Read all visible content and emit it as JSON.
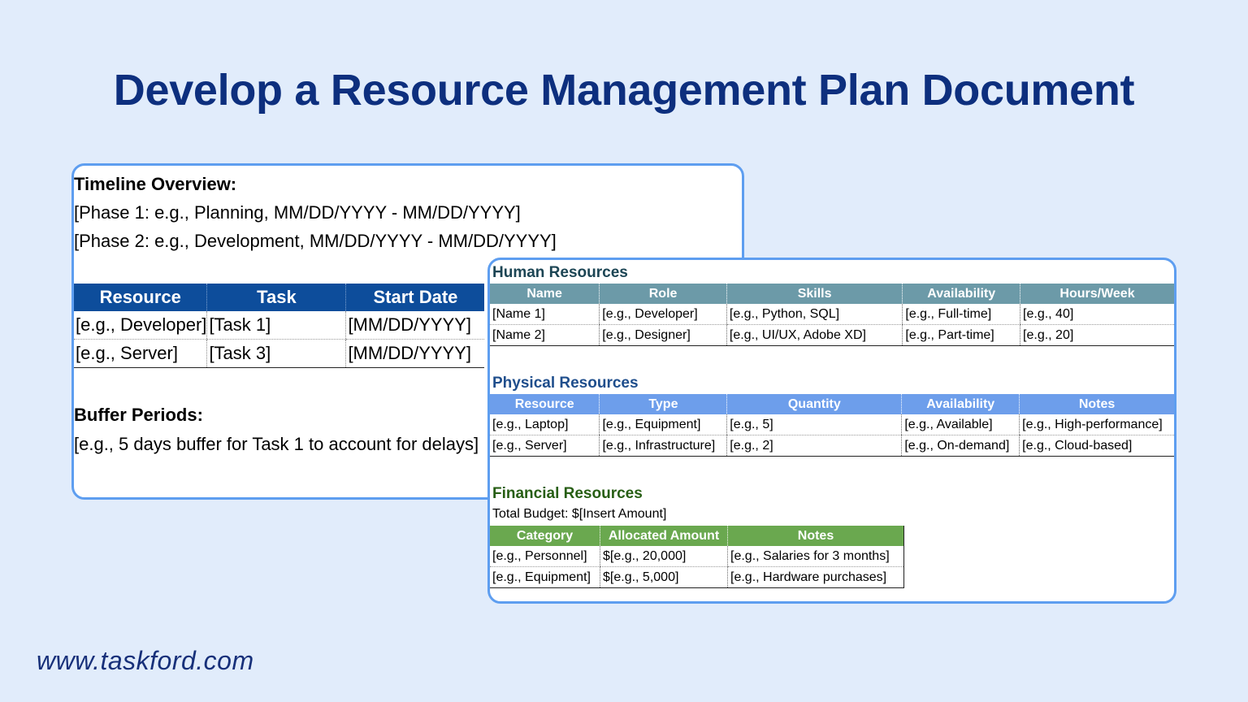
{
  "title": "Develop a Resource Management Plan Document",
  "footer_url": "www.taskford.com",
  "colors": {
    "background": "#e1ecfb",
    "title": "#0d2f7e",
    "card_border": "#5e9ef0",
    "back_header": "#0d4d9b",
    "human_header": "#6c9aa8",
    "physical_header": "#6d9eeb",
    "financial_header": "#6aa84f"
  },
  "back_card": {
    "timeline_heading": "Timeline Overview:",
    "phase1": "[Phase 1: e.g., Planning, MM/DD/YYYY - MM/DD/YYYY]",
    "phase2": "[Phase 2: e.g., Development, MM/DD/YYYY - MM/DD/YYYY]",
    "table": {
      "headers": [
        "Resource",
        "Task",
        "Start Date"
      ],
      "rows": [
        [
          "[e.g., Developer]",
          "[Task 1]",
          "[MM/DD/YYYY]"
        ],
        [
          "[e.g., Server]",
          "[Task 3]",
          "[MM/DD/YYYY]"
        ]
      ]
    },
    "buffer_heading": "Buffer Periods:",
    "buffer_text": "[e.g., 5 days buffer for Task 1 to account for delays]"
  },
  "front_card": {
    "human": {
      "title": "Human Resources",
      "title_color": "#1c4554",
      "headers": [
        "Name",
        "Role",
        "Skills",
        "Availability",
        "Hours/Week"
      ],
      "rows": [
        [
          "[Name 1]",
          "[e.g., Developer]",
          "[e.g., Python, SQL]",
          "[e.g., Full-time]",
          "[e.g., 40]"
        ],
        [
          "[Name 2]",
          "[e.g., Designer]",
          "[e.g., UI/UX, Adobe XD]",
          "[e.g., Part-time]",
          "[e.g., 20]"
        ]
      ]
    },
    "physical": {
      "title": "Physical Resources",
      "title_color": "#1f4e8c",
      "headers": [
        "Resource",
        "Type",
        "Quantity",
        "Availability",
        "Notes"
      ],
      "rows": [
        [
          "[e.g., Laptop]",
          "[e.g., Equipment]",
          "[e.g., 5]",
          "[e.g., Available]",
          "[e.g., High-performance]"
        ],
        [
          "[e.g., Server]",
          "[e.g., Infrastructure]",
          "[e.g., 2]",
          "[e.g., On-demand]",
          "[e.g., Cloud-based]"
        ]
      ]
    },
    "financial": {
      "title": "Financial Resources",
      "title_color": "#275e14",
      "total_budget": "Total Budget: $[Insert Amount]",
      "headers": [
        "Category",
        "Allocated Amount",
        "Notes"
      ],
      "rows": [
        [
          "[e.g., Personnel]",
          "$[e.g., 20,000]",
          "[e.g., Salaries for 3 months]"
        ],
        [
          "[e.g., Equipment]",
          "$[e.g., 5,000]",
          "[e.g., Hardware purchases]"
        ]
      ]
    }
  }
}
